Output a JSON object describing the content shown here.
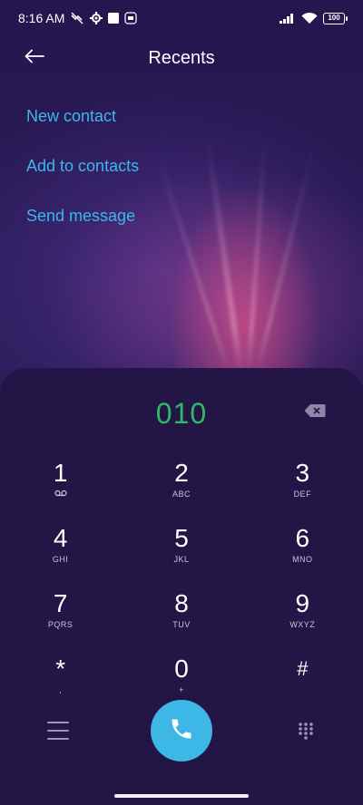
{
  "status_bar": {
    "time": "8:16 AM",
    "left_icons": [
      "missed-call-off-icon",
      "settings-gear-icon",
      "square-notification-icon",
      "radio-icon"
    ],
    "right_icons": [
      "signal-icon",
      "wifi-icon"
    ],
    "battery": "100"
  },
  "header": {
    "title": "Recents",
    "back_icon": "arrow-left-icon"
  },
  "actions": [
    {
      "label": "New contact"
    },
    {
      "label": "Add to contacts"
    },
    {
      "label": "Send message"
    }
  ],
  "dialer": {
    "number": "010",
    "number_color": "#2fb865",
    "accent_color": "#3db6ec",
    "keys": [
      [
        {
          "digit": "1",
          "letters": "ꝏ"
        },
        {
          "digit": "2",
          "letters": "ABC"
        },
        {
          "digit": "3",
          "letters": "DEF"
        }
      ],
      [
        {
          "digit": "4",
          "letters": "GHI"
        },
        {
          "digit": "5",
          "letters": "JKL"
        },
        {
          "digit": "6",
          "letters": "MNO"
        }
      ],
      [
        {
          "digit": "7",
          "letters": "PQRS"
        },
        {
          "digit": "8",
          "letters": "TUV"
        },
        {
          "digit": "9",
          "letters": "WXYZ"
        }
      ],
      [
        {
          "digit": "*",
          "letters": ","
        },
        {
          "digit": "0",
          "letters": "+"
        },
        {
          "digit": "#",
          "letters": ""
        }
      ]
    ]
  }
}
